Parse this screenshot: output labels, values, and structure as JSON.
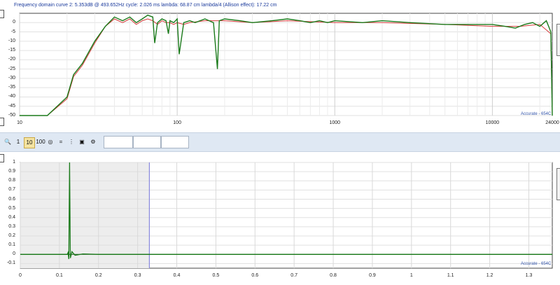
{
  "status_bar": {
    "text": "Frequency domain curve 2:  5.353dB @ 493.652Hz     cycle: 2.026 ms    lambda: 68.87 cm    lambda/4 (Allison effect): 17.22 cm"
  },
  "colors": {
    "series_green": "#1a7a1a",
    "series_red": "#d43a3a",
    "cursor_line": "#8888dd",
    "toolbar_bg": "#dfe8f3"
  },
  "freq_panel": {
    "watermark": "Accurate - 654C",
    "y_ticks": [
      "0",
      "-5",
      "-10",
      "-15",
      "-20",
      "-25",
      "-30",
      "-35",
      "-40",
      "-45",
      "-50"
    ],
    "x_ticks": [
      "10",
      "100",
      "1000",
      "10000",
      "24000"
    ]
  },
  "toolbar": {
    "buttons": [
      {
        "name": "zoom-in-icon",
        "label": "🔍"
      },
      {
        "name": "zoom-1-button",
        "label": "1"
      },
      {
        "name": "zoom-10-button",
        "label": "10"
      },
      {
        "name": "zoom-100-button",
        "label": "100"
      },
      {
        "name": "target-icon",
        "label": "◎"
      },
      {
        "name": "equals-icon",
        "label": "="
      },
      {
        "name": "cursor-icon",
        "label": "⋮"
      },
      {
        "name": "monitor-icon",
        "label": "▣"
      },
      {
        "name": "settings-icon",
        "label": "⚙"
      }
    ],
    "input_values": [
      "",
      "",
      ""
    ]
  },
  "time_panel": {
    "watermark": "Accurate - 654C",
    "y_ticks": [
      "1",
      "0.9",
      "0.8",
      "0.7",
      "0.6",
      "0.5",
      "0.4",
      "0.3",
      "0.2",
      "0.1",
      "0",
      "-0.1"
    ],
    "x_ticks": [
      "0",
      "0.1",
      "0.2",
      "0.3",
      "0.4",
      "0.5",
      "0.6",
      "0.7",
      "0.8",
      "0.9",
      "1",
      "1.1",
      "1.2",
      "1.3"
    ]
  },
  "chart_data": [
    {
      "type": "line",
      "xscale": "log",
      "xlim": [
        10,
        24000
      ],
      "ylim": [
        -50,
        5
      ],
      "series": [
        {
          "color": "#1a7a1a",
          "x": [
            10,
            15,
            20,
            22,
            25,
            30,
            35,
            40,
            45,
            50,
            55,
            60,
            65,
            70,
            72,
            75,
            80,
            85,
            88,
            90,
            95,
            100,
            103,
            110,
            120,
            130,
            150,
            170,
            180,
            185,
            200,
            250,
            300,
            400,
            500,
            600,
            700,
            800,
            900,
            1000,
            1500,
            2000,
            3000,
            5000,
            8000,
            10000,
            12000,
            14000,
            16000,
            18000,
            20000,
            22000,
            23500,
            24000
          ],
          "y": [
            -60,
            -50,
            -40,
            -28,
            -22,
            -10,
            -2,
            3,
            1,
            3,
            0,
            2,
            4,
            3,
            -11,
            0,
            2,
            1,
            -6,
            1,
            0,
            2,
            -17,
            0,
            1,
            0,
            2,
            0,
            -25,
            1,
            2,
            1,
            0,
            1,
            2,
            1,
            0,
            1,
            0,
            1,
            0,
            1,
            0,
            -1,
            -1,
            -1,
            -2,
            -3,
            -1,
            0,
            -2,
            1,
            -5,
            -50
          ]
        },
        {
          "color": "#d43a3a",
          "x": [
            10,
            15,
            20,
            22,
            25,
            30,
            35,
            40,
            45,
            50,
            55,
            60,
            65,
            70,
            75,
            80,
            85,
            90,
            95,
            100,
            110,
            120,
            150,
            200,
            300,
            500,
            1000,
            2000,
            5000,
            10000,
            15000,
            20000,
            23500,
            24000
          ],
          "y": [
            -61,
            -51,
            -41,
            -29,
            -23,
            -11,
            -2,
            2,
            0,
            2,
            -1,
            1,
            2,
            1,
            -1,
            1,
            0,
            0,
            -1,
            0,
            -1,
            0,
            1,
            1,
            0,
            1,
            0,
            0,
            -1,
            -2,
            -2,
            -1,
            -6,
            -50
          ]
        }
      ]
    },
    {
      "type": "line",
      "xlim": [
        0,
        1.36
      ],
      "ylim": [
        -0.15,
        1.0
      ],
      "series": [
        {
          "color": "#1a7a1a",
          "x": [
            0,
            0.12,
            0.122,
            0.124,
            0.126,
            0.128,
            0.132,
            0.14,
            0.16,
            0.2,
            0.3,
            1.36
          ],
          "y": [
            0,
            0,
            0.02,
            -0.05,
            1.0,
            -0.04,
            0.03,
            -0.01,
            0.005,
            0,
            0,
            0
          ]
        }
      ]
    }
  ]
}
